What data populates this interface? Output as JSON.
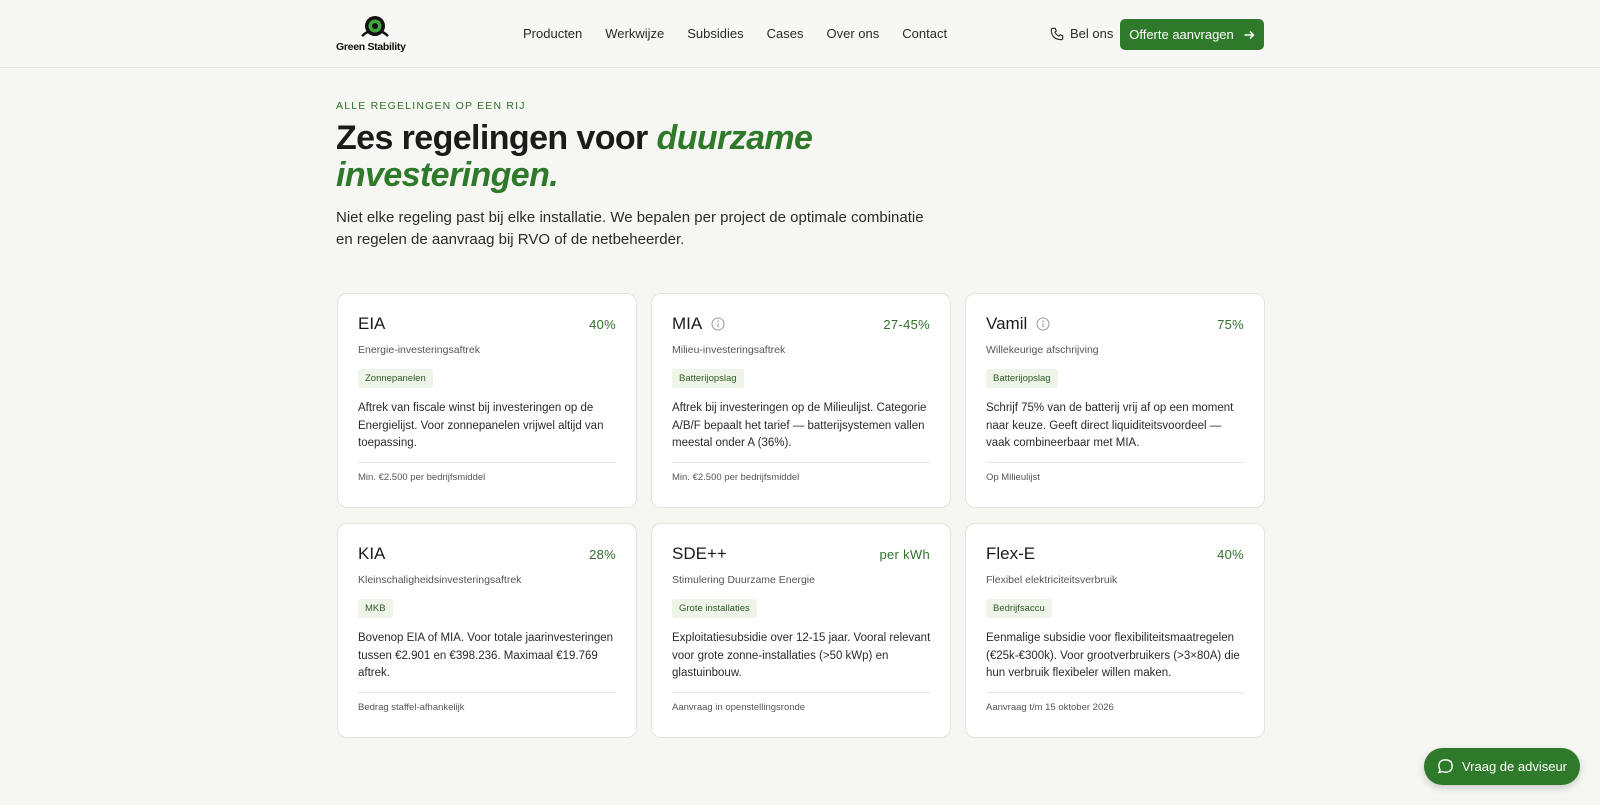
{
  "brand": {
    "name": "Green Stability"
  },
  "nav": {
    "items": [
      {
        "label": "Producten"
      },
      {
        "label": "Werkwijze"
      },
      {
        "label": "Subsidies"
      },
      {
        "label": "Cases"
      },
      {
        "label": "Over ons"
      },
      {
        "label": "Contact"
      }
    ],
    "call_label": "Bel ons",
    "cta_label": "Offerte aanvragen"
  },
  "hero": {
    "eyebrow": "Alle regelingen op een rij",
    "headline_plain": "Zes regelingen voor ",
    "headline_accent": "duurzame investeringen.",
    "intro": "Niet elke regeling past bij elke installatie. We bepalen per project de optimale combinatie en regelen de aanvraag bij RVO of de netbeheerder."
  },
  "cards": [
    {
      "title": "EIA",
      "info_icon": false,
      "pct": "40%",
      "subtitle": "Energie-investeringsaftrek",
      "tag": "Zonnepanelen",
      "description": "Aftrek van fiscale winst bij investeringen op de Energielijst. Voor zonnepanelen vrijwel altijd van toepassing.",
      "footer": "Min. €2.500 per bedrijfsmiddel"
    },
    {
      "title": "MIA",
      "info_icon": true,
      "pct": "27-45%",
      "subtitle": "Milieu-investeringsaftrek",
      "tag": "Batterijopslag",
      "description": "Aftrek bij investeringen op de Milieulijst. Categorie A/B/F bepaalt het tarief — batterijsystemen vallen meestal onder A (36%).",
      "footer": "Min. €2.500 per bedrijfsmiddel"
    },
    {
      "title": "Vamil",
      "info_icon": true,
      "pct": "75%",
      "subtitle": "Willekeurige afschrijving",
      "tag": "Batterijopslag",
      "description": "Schrijf 75% van de batterij vrij af op een moment naar keuze. Geeft direct liquiditeitsvoordeel — vaak combineerbaar met MIA.",
      "footer": "Op Milieulijst"
    },
    {
      "title": "KIA",
      "info_icon": false,
      "pct": "28%",
      "subtitle": "Kleinschaligheidsinvesteringsaftrek",
      "tag": "MKB",
      "description": "Bovenop EIA of MIA. Voor totale jaarinvesteringen tussen €2.901 en €398.236. Maximaal €19.769 aftrek.",
      "footer": "Bedrag staffel-afhankelijk"
    },
    {
      "title": "SDE++",
      "info_icon": false,
      "pct": "per kWh",
      "subtitle": "Stimulering Duurzame Energie",
      "tag": "Grote installaties",
      "description": "Exploitatiesubsidie over 12-15 jaar. Vooral relevant voor grote zonne-installaties (>50 kWp) en glastuinbouw.",
      "footer": "Aanvraag in openstellingsronde"
    },
    {
      "title": "Flex-E",
      "info_icon": false,
      "pct": "40%",
      "subtitle": "Flexibel elektriciteitsverbruik",
      "tag": "Bedrijfsaccu",
      "description": "Eenmalige subsidie voor flexibiliteitsmaatregelen (€25k-€300k). Voor grootverbruikers (>3×80A) die hun verbruik flexibeler willen maken.",
      "footer": "Aanvraag t/m 15 oktober 2026"
    }
  ],
  "chat": {
    "label": "Vraag de adviseur"
  },
  "colors": {
    "accent": "#2f7a2a",
    "background": "#f6f6f3",
    "card": "#ffffff"
  }
}
